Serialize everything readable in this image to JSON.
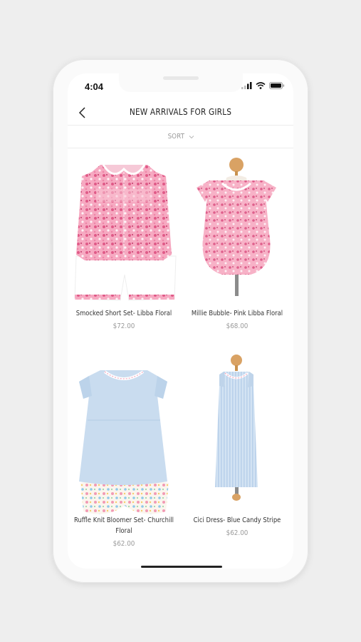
{
  "status_bar": {
    "time": "4:04"
  },
  "header": {
    "title": "NEW ARRIVALS FOR GIRLS"
  },
  "sort": {
    "label": "SORT"
  },
  "products": [
    {
      "name": "Smocked Short Set- Libba Floral",
      "price": "$72.00"
    },
    {
      "name": "Millie Bubble- Pink Libba Floral",
      "price": "$68.00"
    },
    {
      "name": "Ruffle Knit Bloomer Set- Churchill Floral",
      "price": "$62.00"
    },
    {
      "name": "Cici Dress- Blue Candy Stripe",
      "price": "$62.00"
    }
  ],
  "icons": {
    "back": "chevron-left-icon",
    "sort": "chevron-down-icon",
    "signal": "signal-icon",
    "wifi": "wifi-icon",
    "battery": "battery-icon"
  },
  "colors": {
    "pink_floral": "#e8739a",
    "light_blue": "#c9dcef",
    "background": "#eeeeee"
  }
}
